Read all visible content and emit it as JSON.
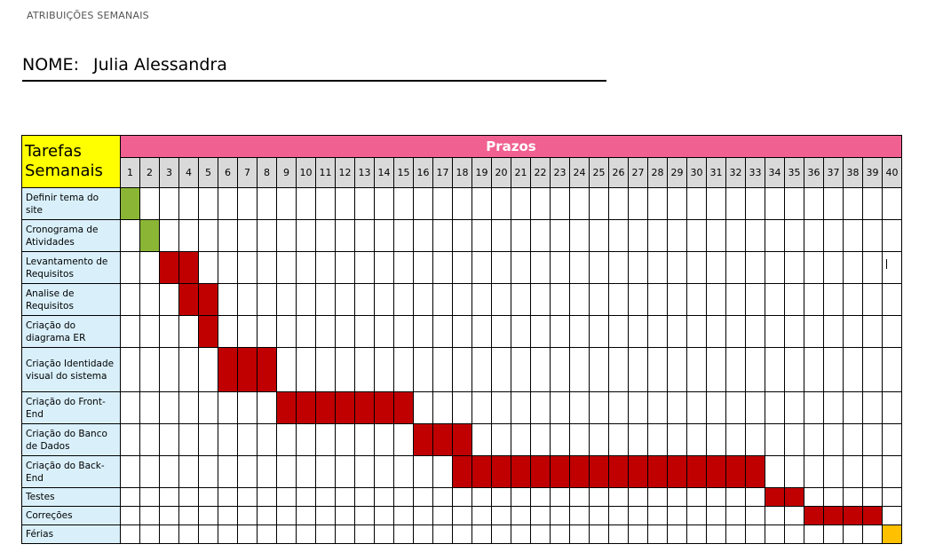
{
  "header": {
    "title": "ATRIBUIÇÕES SEMANAIS"
  },
  "name": {
    "label": "NOME:",
    "value": "Julia Alessandra"
  },
  "table": {
    "tasks_header_line1": "Tarefas",
    "tasks_header_line2": "Semanais",
    "deadlines_header": "Prazos",
    "weeks": [
      "1",
      "2",
      "3",
      "4",
      "5",
      "6",
      "7",
      "8",
      "9",
      "10",
      "11",
      "12",
      "13",
      "14",
      "15",
      "16",
      "17",
      "18",
      "19",
      "20",
      "21",
      "22",
      "23",
      "24",
      "25",
      "26",
      "27",
      "28",
      "29",
      "30",
      "31",
      "32",
      "33",
      "34",
      "35",
      "36",
      "37",
      "38",
      "39",
      "40"
    ],
    "colors": {
      "done": "#8bb635",
      "planned": "#c00000",
      "vacation": "#ffc000",
      "header_yellow": "#ffff00",
      "header_pink": "#f06090",
      "task_bg": "#d9f0fb",
      "week_bg": "#d9d9d9"
    },
    "rows": [
      {
        "task": "Definir tema do site",
        "start": 1,
        "end": 1,
        "status": "done"
      },
      {
        "task": "Cronograma de Atividades",
        "start": 2,
        "end": 2,
        "status": "done"
      },
      {
        "task": "Levantamento de Requisitos",
        "start": 3,
        "end": 4,
        "status": "planned"
      },
      {
        "task": "Analise de Requisitos",
        "start": 4,
        "end": 5,
        "status": "planned"
      },
      {
        "task": "Criação do diagrama ER",
        "start": 5,
        "end": 5,
        "status": "planned"
      },
      {
        "task": "Criação Identidade visual do sistema",
        "start": 6,
        "end": 8,
        "status": "planned"
      },
      {
        "task": "Criação do Front-End",
        "start": 9,
        "end": 15,
        "status": "planned"
      },
      {
        "task": "Criação do Banco de Dados",
        "start": 16,
        "end": 18,
        "status": "planned"
      },
      {
        "task": "Criação do Back-End",
        "start": 18,
        "end": 33,
        "status": "planned"
      },
      {
        "task": "Testes",
        "start": 34,
        "end": 35,
        "status": "planned"
      },
      {
        "task": "Correções",
        "start": 36,
        "end": 39,
        "status": "planned"
      },
      {
        "task": "Férias",
        "start": 40,
        "end": 40,
        "status": "vacation"
      }
    ]
  }
}
